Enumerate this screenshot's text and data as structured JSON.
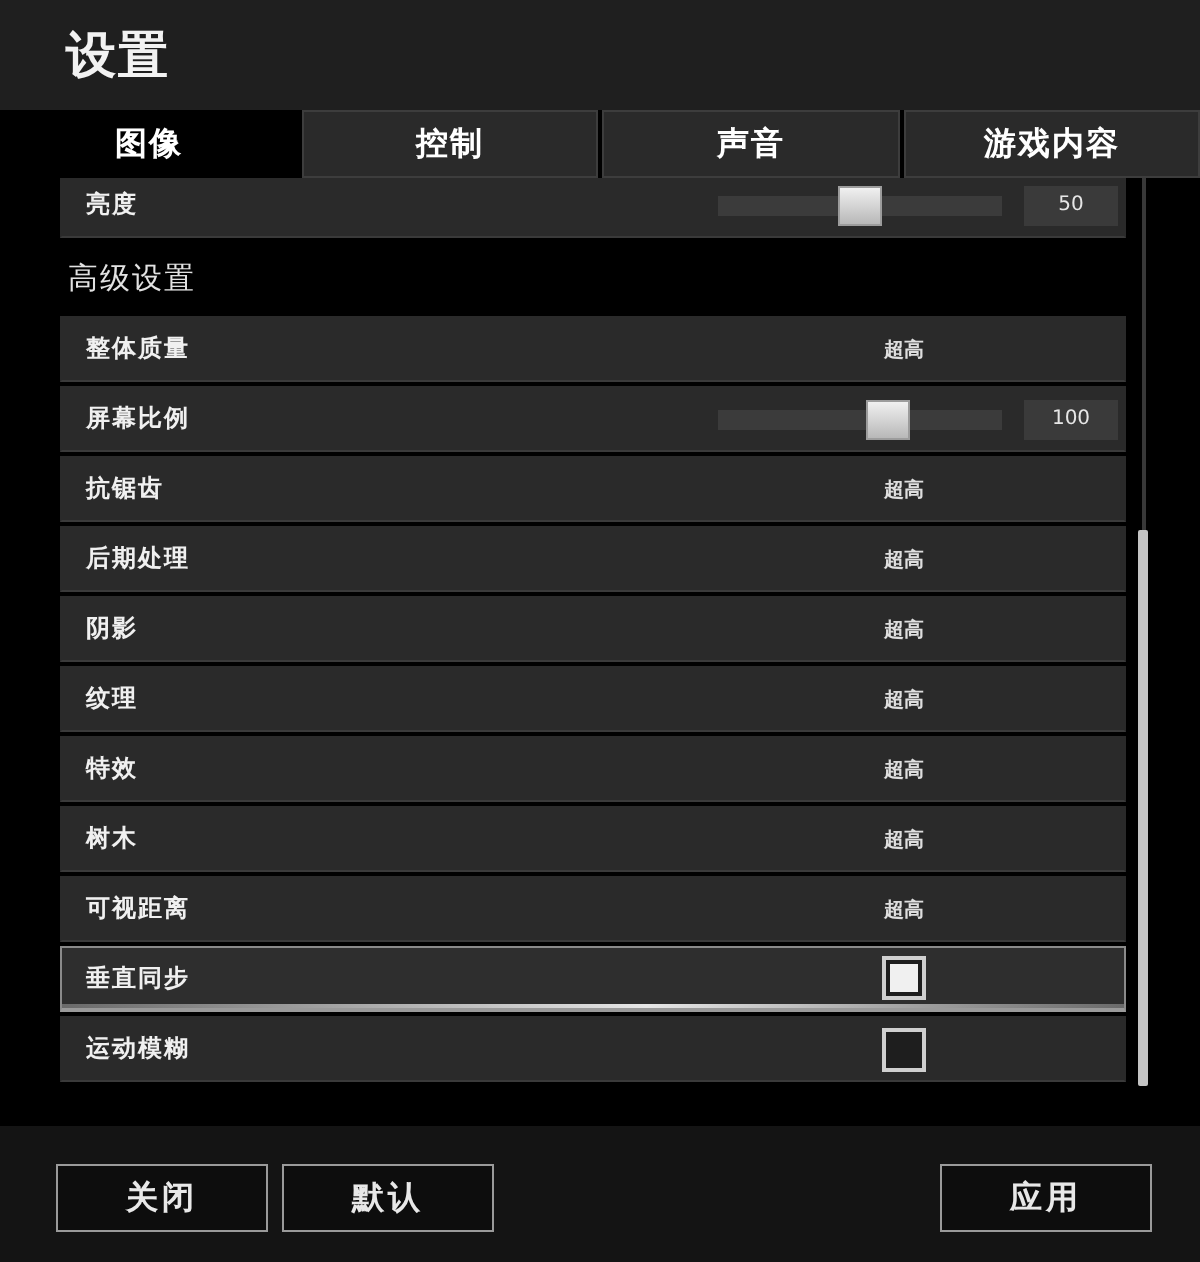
{
  "window": {
    "title": "设置"
  },
  "tabs": [
    {
      "label": "图像",
      "selected": true
    },
    {
      "label": "控制",
      "selected": false
    },
    {
      "label": "声音",
      "selected": false
    },
    {
      "label": "游戏内容",
      "selected": false
    }
  ],
  "general": {
    "rows": [
      {
        "kind": "slider",
        "label": "亮度",
        "level": 0.5,
        "reading": "50",
        "selected": false
      }
    ]
  },
  "advanced": {
    "title": "高级设置",
    "rows": [
      {
        "kind": "choice",
        "label": "整体质量",
        "value": "超高",
        "selected": false
      },
      {
        "kind": "slider",
        "label": "屏幕比例",
        "level": 0.6,
        "reading": "100",
        "selected": false
      },
      {
        "kind": "choice",
        "label": "抗锯齿",
        "value": "超高",
        "selected": false
      },
      {
        "kind": "choice",
        "label": "后期处理",
        "value": "超高",
        "selected": false
      },
      {
        "kind": "choice",
        "label": "阴影",
        "value": "超高",
        "selected": false
      },
      {
        "kind": "choice",
        "label": "纹理",
        "value": "超高",
        "selected": false
      },
      {
        "kind": "choice",
        "label": "特效",
        "value": "超高",
        "selected": false
      },
      {
        "kind": "choice",
        "label": "树木",
        "value": "超高",
        "selected": false
      },
      {
        "kind": "choice",
        "label": "可视距离",
        "value": "超高",
        "selected": false
      },
      {
        "kind": "checkbox",
        "label": "垂直同步",
        "checked": true,
        "selected": true
      },
      {
        "kind": "checkbox",
        "label": "运动模糊",
        "checked": false,
        "selected": false
      }
    ]
  },
  "footer": {
    "left_buttons": [
      {
        "label": "关闭"
      },
      {
        "label": "默认"
      }
    ],
    "right_buttons": [
      {
        "label": "应用"
      }
    ]
  }
}
